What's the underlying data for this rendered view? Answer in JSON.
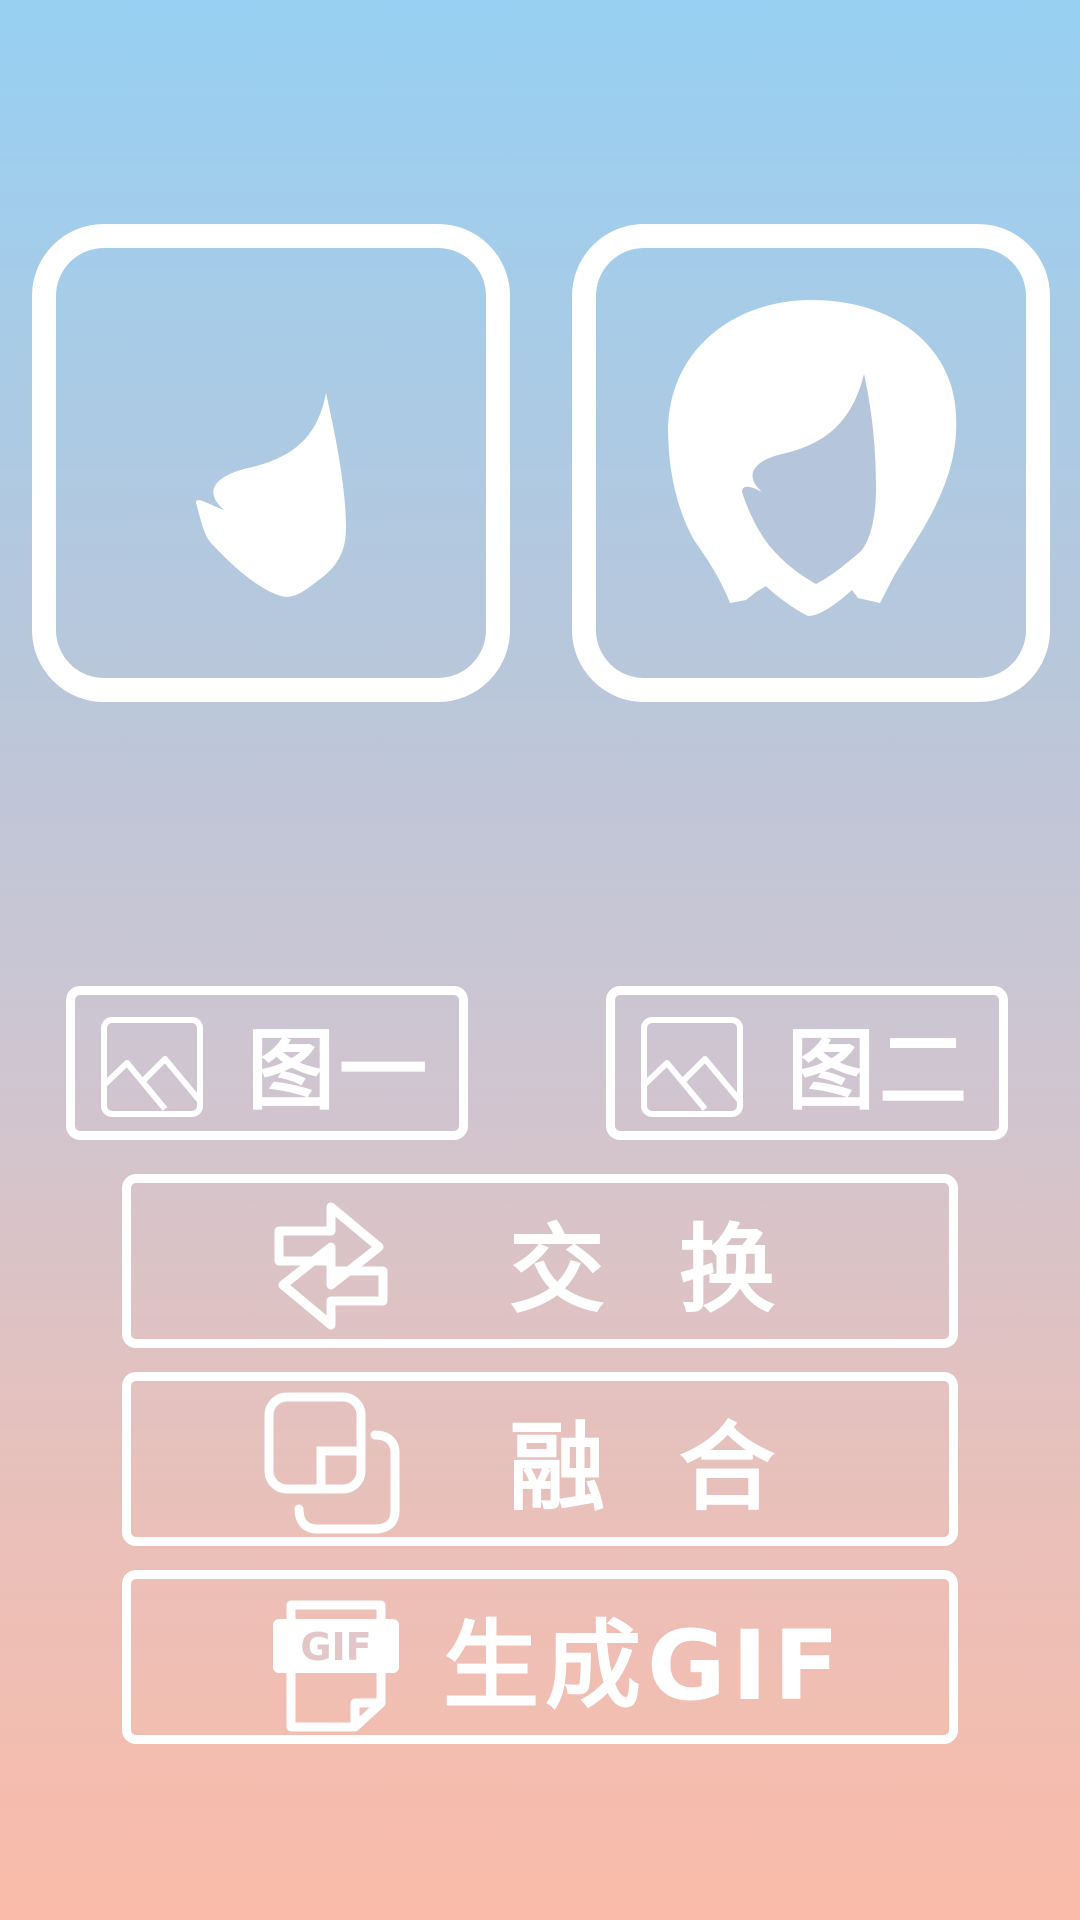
{
  "slots": [
    {
      "name": "slot-1",
      "icon": "face-outline-icon"
    },
    {
      "name": "slot-2",
      "icon": "hair-face-icon"
    }
  ],
  "pickers": [
    {
      "label": "图一",
      "icon": "image-icon"
    },
    {
      "label": "图二",
      "icon": "image-icon"
    }
  ],
  "actions": {
    "swap": {
      "label": "交换",
      "icon": "swap-arrows-icon"
    },
    "merge": {
      "label": "融合",
      "icon": "merge-squares-icon"
    },
    "gif": {
      "label": "生成GIF",
      "icon": "gif-file-icon",
      "icon_text": "GIF"
    }
  },
  "colors": {
    "gradient_top": "#97d0f3",
    "gradient_bottom": "#fabba9",
    "foreground": "#ffffff"
  }
}
